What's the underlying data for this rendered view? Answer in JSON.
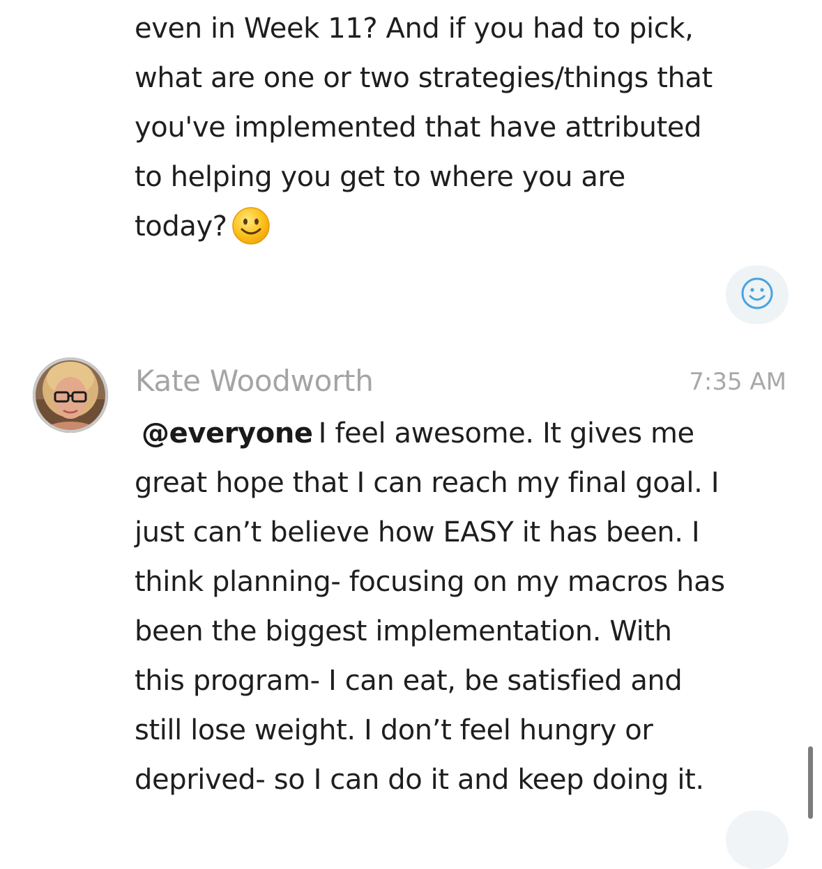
{
  "previous_message": {
    "lines": [
      "even in Week 11? And if you had to pick,",
      "what are one or two strategies/things that",
      "you've implemented that have attributed",
      "to helping you get to where you are",
      "today?"
    ],
    "trailing_emoji": "slightly-smiling-face-emoji"
  },
  "reaction_button": {
    "icon": "add-reaction-smiley-icon",
    "color": "#4aa3df"
  },
  "message": {
    "author": "Kate Woodworth",
    "time": "7:35 AM",
    "avatar": "author-avatar-photo",
    "mention": "@everyone",
    "first_line_rest": "I feel awesome. It gives me",
    "lines": [
      "great hope that I can reach my final goal. I",
      "just can’t believe how EASY it has been. I",
      "think planning- focusing on my macros has",
      "been the biggest implementation. With",
      "this program- I can eat, be satisfied and",
      "still lose weight. I don’t feel hungry or",
      "deprived- so I can do it and keep doing it."
    ]
  },
  "colors": {
    "text": "#1e1e1e",
    "author_name": "#a4a4a4",
    "timestamp": "#a8a8a8",
    "reaction_bg": "#eef3f6",
    "accent": "#4aa3df"
  }
}
